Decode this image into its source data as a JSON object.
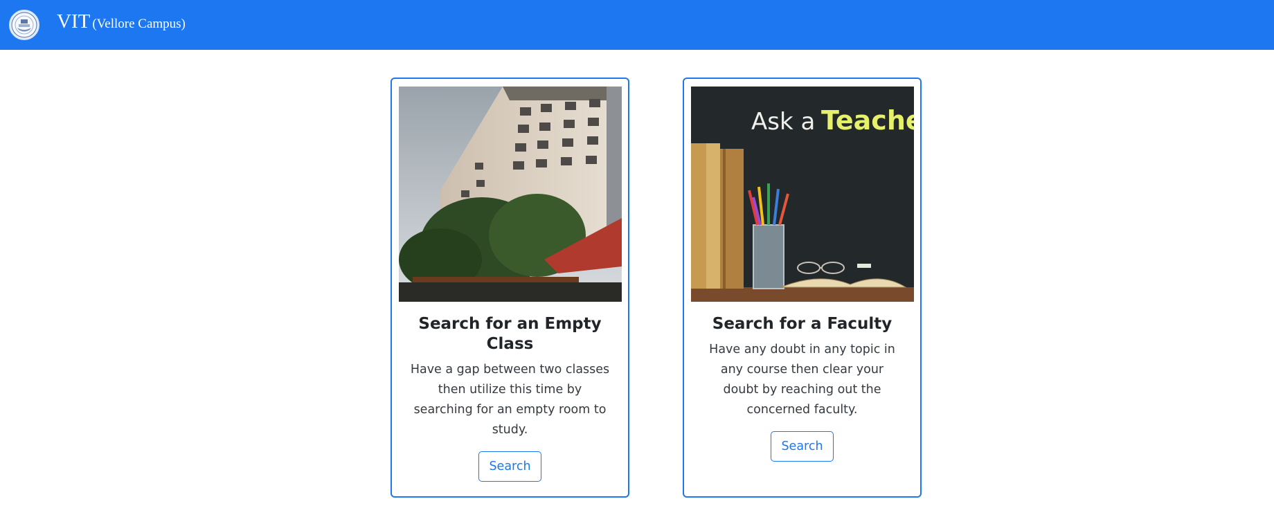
{
  "navbar": {
    "brand_name": "VIT",
    "brand_sub": "(Vellore Campus)",
    "logo_icon": "vit-seal-logo",
    "color": "#1c77f0"
  },
  "cards": [
    {
      "image": "building-photo",
      "title": "Search for an Empty Class",
      "text": "Have a gap between two classes then utilize this time by searching for an empty room to study.",
      "button_label": "Search"
    },
    {
      "image": "ask-a-teacher-chalkboard-photo",
      "image_text_1": "Ask a",
      "image_text_2": "Teacher",
      "title": "Search for a Faculty",
      "text": "Have any doubt in any topic in any course then clear your doubt by reaching out the concerned faculty.",
      "button_label": "Search"
    }
  ]
}
